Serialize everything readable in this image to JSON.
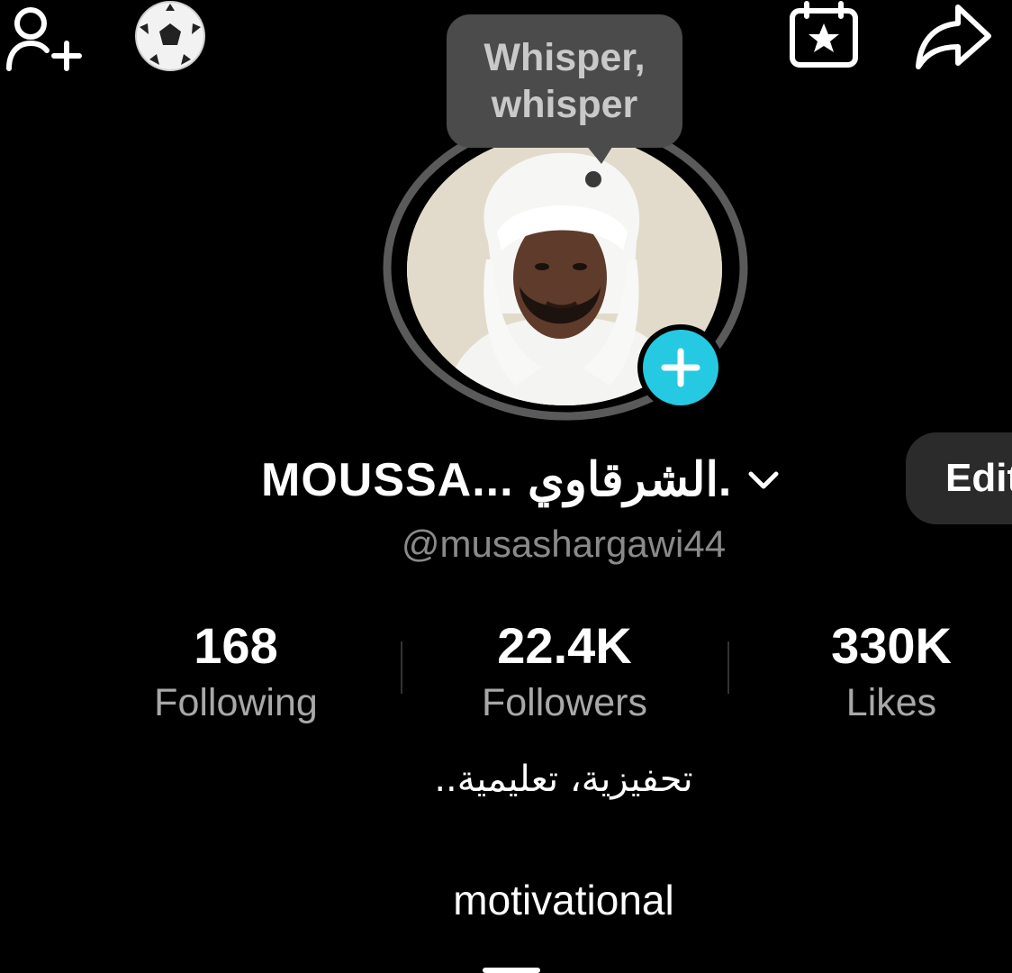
{
  "tooltip": {
    "line1": "Whisper,",
    "line2": "whisper"
  },
  "profile": {
    "display_name": "MOUSSA... الشرقاوي.",
    "handle": "@musashargawi44",
    "edit_label": "Edit"
  },
  "stats": {
    "following": {
      "value": "168",
      "label": "Following"
    },
    "followers": {
      "value": "22.4K",
      "label": "Followers"
    },
    "likes": {
      "value": "330K",
      "label": "Likes"
    }
  },
  "bio": {
    "arabic": "تحفيزية، تعليمية..",
    "english": "motivational"
  },
  "icons": {
    "top_left": [
      "add-friend-icon",
      "soccer-ball-icon"
    ],
    "top_right": [
      "calendar-star-icon",
      "share-icon"
    ],
    "avatar_badge": "plus-icon"
  },
  "colors": {
    "background": "#000000",
    "accent_badge": "#26c9e2",
    "tooltip_bg": "#4b4b4b",
    "secondary_text": "#a8a8a8",
    "edit_button_bg": "#2b2b2b"
  }
}
